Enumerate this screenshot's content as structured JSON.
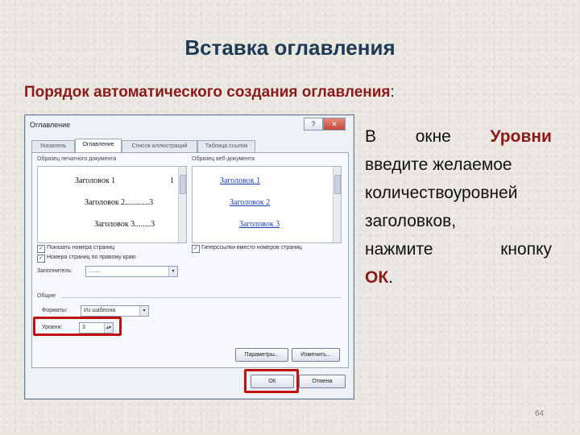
{
  "slide": {
    "title": "Вставка оглавления",
    "subtitle": "Порядок автоматического создания оглавления",
    "subtitle_colon": ":",
    "page_number": "64"
  },
  "body": {
    "w_in": "В",
    "w_window": "окне",
    "w_levels": "Уровни",
    "line2": "введите желаемое",
    "line3": "количествоуровней",
    "line4": "заголовков,",
    "w_press": "нажмите",
    "w_button": "кнопку",
    "w_ok": "ОК",
    "w_dot": "."
  },
  "dialog": {
    "title": "Оглавление",
    "help_icon": "?",
    "close_icon": "✕",
    "tabs": [
      "Указатель",
      "Оглавление",
      "Список иллюстраций",
      "Таблица ссылок"
    ],
    "print_preview_label": "Образец печатного документа",
    "web_preview_label": "Образец веб-документа",
    "print_lines": [
      {
        "text": "Заголовок 1",
        "page": "1"
      },
      {
        "text": "Заголовок 2............3",
        "page": ""
      },
      {
        "text": "Заголовок 3........3",
        "page": ""
      }
    ],
    "web_links": [
      "Заголовок 1",
      "Заголовок 2",
      "Заголовок 3"
    ],
    "show_page_numbers": "Показать номера страниц",
    "right_align_numbers": "Номера страниц по правому краю",
    "hyperlinks_instead": "Гиперссылки вместо номеров страниц",
    "tab_leader_label": "Заполнитель:",
    "tab_leader_value": ".......",
    "general_label": "Общие",
    "formats_label": "Форматы:",
    "formats_value": "Из шаблона",
    "levels_label": "Уровни:",
    "levels_value": "3",
    "options_button": "Параметры...",
    "modify_button": "Изменить...",
    "ok_button": "ОК",
    "cancel_button": "Отмена",
    "checkbox_mark": "✓",
    "dropdown_arrow": "▾",
    "spinner_arrows": "▴▾",
    "highlight_color": "#c11212"
  }
}
